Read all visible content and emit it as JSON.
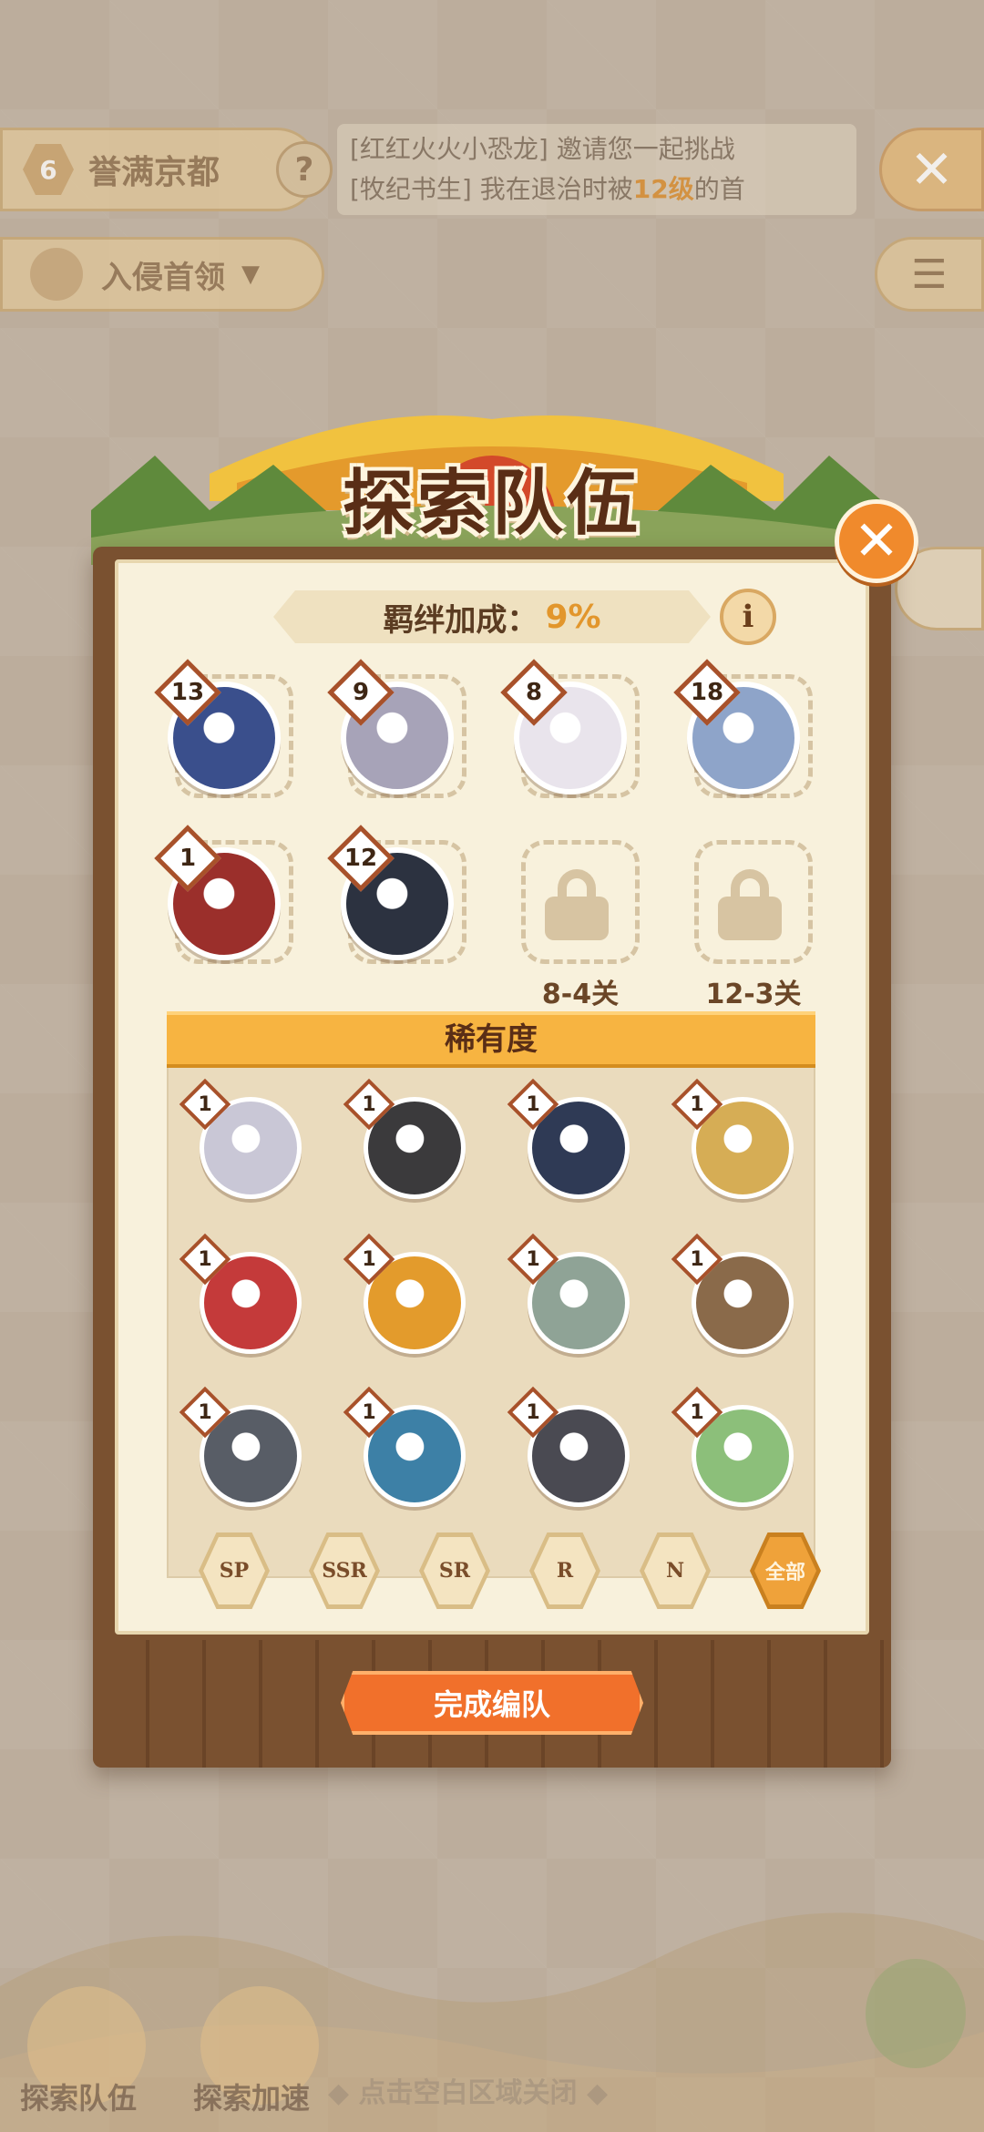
{
  "hud": {
    "stage_number": "6",
    "stage_title": "誉满京都",
    "help_label": "?",
    "message_line1": "[红红火火小恐龙] 邀请您一起挑战",
    "message_line2_prefix": "[牧纪书生] 我在退治时被",
    "message_line2_highlight": "12级",
    "message_line2_suffix": "的首",
    "boss_label": "入侵首领",
    "boss_arrow": "▼",
    "close_label": "✕",
    "list_label": "☰"
  },
  "panel": {
    "title": "探索队伍",
    "close_label": "✕",
    "bond_label": "羁绊加成：",
    "bond_value": "9%",
    "info_label": "i"
  },
  "team": {
    "members": [
      {
        "level": "13",
        "color": "#3a4f8c"
      },
      {
        "level": "9",
        "color": "#a7a3b8"
      },
      {
        "level": "8",
        "color": "#e9e4ec"
      },
      {
        "level": "18",
        "color": "#8ea4c9"
      },
      {
        "level": "1",
        "color": "#9b2f2b"
      },
      {
        "level": "12",
        "color": "#2c3240"
      }
    ],
    "locked": [
      {
        "requirement": "8-4关"
      },
      {
        "requirement": "12-3关"
      }
    ]
  },
  "rarity": {
    "header": "稀有度",
    "roster": [
      {
        "level": "1",
        "color": "#c9c7d6"
      },
      {
        "level": "1",
        "color": "#3b3a3c"
      },
      {
        "level": "1",
        "color": "#2f3a55"
      },
      {
        "level": "1",
        "color": "#d6ad55"
      },
      {
        "level": "1",
        "color": "#c43a3a"
      },
      {
        "level": "1",
        "color": "#e39b2c"
      },
      {
        "level": "1",
        "color": "#8fa396"
      },
      {
        "level": "1",
        "color": "#8a6a4a"
      },
      {
        "level": "1",
        "color": "#585d66"
      },
      {
        "level": "1",
        "color": "#3d80a6"
      },
      {
        "level": "1",
        "color": "#4a4a52"
      },
      {
        "level": "1",
        "color": "#8cbf7a"
      }
    ],
    "filters": [
      "SP",
      "SSR",
      "SR",
      "R",
      "N",
      "全部"
    ],
    "active_filter": "全部"
  },
  "confirm_label": "完成编队",
  "bottom": {
    "explore_team": "探索队伍",
    "explore_speed": "探索加速",
    "close_hint": "◆ 点击空白区域关闭 ◆"
  }
}
